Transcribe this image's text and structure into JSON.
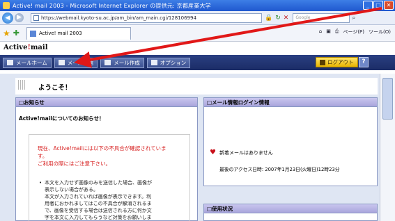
{
  "window": {
    "title": "Active! mail 2003 - Microsoft Internet Explorer の提供元: 京都産業大学",
    "controls": [
      "_",
      "□",
      "✕"
    ]
  },
  "address_bar": {
    "url": "https://webmail.kyoto-su.ac.jp/am_bin/am_main.cgi/128106994",
    "search_placeholder": "Google"
  },
  "tab": {
    "label": "Active! mail 2003"
  },
  "command_bar": [
    "ページ(P)",
    "ツール(O)"
  ],
  "header": {
    "logo_text": "Active",
    "logo_slash": "!",
    "logo_suffix": "mail",
    "nav": [
      {
        "label": "メールホーム"
      },
      {
        "label": "メール受信"
      },
      {
        "label": "メール作成"
      },
      {
        "label": "オプション"
      }
    ],
    "logout_label": "ログアウト",
    "help_label": "?"
  },
  "welcome": "ようこそ！",
  "news_panel": {
    "title": "□お知らせ",
    "subtitle": "Active!mailについてのお知らせ！",
    "notice_lines": [
      "現在、Active!mailには以下の不具合が確認されていま",
      "す。",
      "ご利用の際にはご注意下さい。"
    ],
    "bullet_lines": [
      "本文を入力せず画像のみを送信した場合、画像が",
      "表示しない場合がある。",
      "本文が入力されていれば画像が表示できます。利",
      "用者におかれましてはこの不具合が解消されるま",
      "で、画像を受信する場合は送信される方に何か文",
      "字を本文に入力してもらうなど対策をお願いしま"
    ]
  },
  "login_panel": {
    "title": "□メール情報ログイン情報",
    "new_mail": "新着メールはありません",
    "last_access": "最後のアクセス日時: 2007年1月23日(火曜日)12時23分"
  },
  "usage_panel": {
    "title": "□使用状況"
  },
  "colors": {
    "nav_band": "#1b2c66",
    "panel_head": "#b0acdf",
    "annotation_arrow": "#e11818",
    "notice_text": "#d72020"
  }
}
